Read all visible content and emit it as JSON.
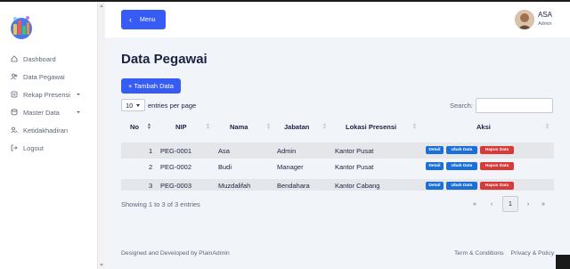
{
  "sidebar": {
    "items": [
      {
        "label": "Dashboard",
        "icon": "home-icon",
        "has_caret": false
      },
      {
        "label": "Data Pegawai",
        "icon": "users-icon",
        "has_caret": false
      },
      {
        "label": "Rekap Presensi",
        "icon": "file-icon",
        "has_caret": true
      },
      {
        "label": "Master Data",
        "icon": "database-icon",
        "has_caret": true
      },
      {
        "label": "Ketidakhadiran",
        "icon": "user-x-icon",
        "has_caret": false
      },
      {
        "label": "Logout",
        "icon": "logout-icon",
        "has_caret": false
      }
    ]
  },
  "header": {
    "menu_label": "Menu",
    "user_name": "ASA",
    "user_role": "Admin"
  },
  "main": {
    "title": "Data Pegawai",
    "add_label": "+ Tambah Data",
    "length_value": "10",
    "length_suffix": "entries per page",
    "search_label": "Search:",
    "search_value": ""
  },
  "table": {
    "headers": [
      "No",
      "NIP",
      "Nama",
      "Jabatan",
      "Lokasi Presensi",
      "Aksi"
    ],
    "rows": [
      {
        "no": "1",
        "nip": "PEG-0001",
        "nama": "Asa",
        "jabatan": "Admin",
        "lokasi": "Kantor Pusat"
      },
      {
        "no": "2",
        "nip": "PEG-0002",
        "nama": "Budi",
        "jabatan": "Manager",
        "lokasi": "Kantor Pusat"
      },
      {
        "no": "3",
        "nip": "PEG-0003",
        "nama": "Muzdalifah",
        "jabatan": "Bendahara",
        "lokasi": "Kantor Cabang"
      }
    ],
    "actions": {
      "detail": "Detail",
      "ubah": "Ubah Data",
      "hapus": "Hapus Data"
    }
  },
  "pagination": {
    "info": "Showing 1 to 3 of 3 entries",
    "first": "«",
    "prev": "‹",
    "current": "1",
    "next": "›",
    "last": "»"
  },
  "footer": {
    "left": "Designed and Developed by PlainAdmin",
    "terms": "Term & Conditions",
    "privacy": "Privacy & Policy"
  },
  "colors": {
    "accent": "#365cf5",
    "danger": "#d83a3a",
    "info": "#1d6fd8"
  }
}
